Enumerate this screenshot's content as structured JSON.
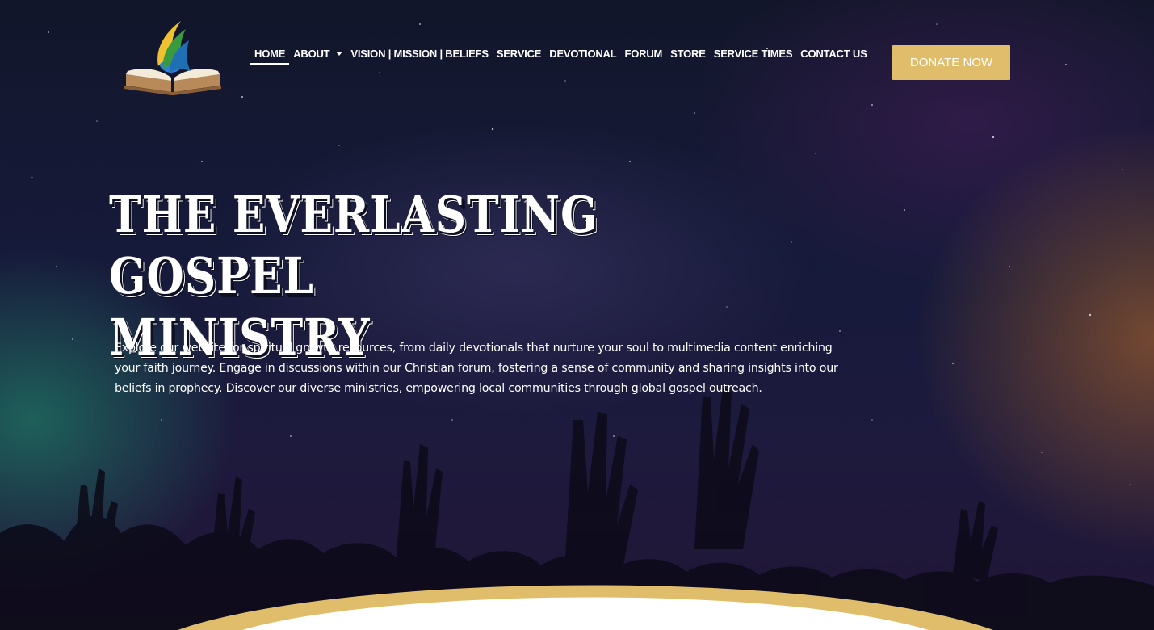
{
  "brand": {
    "logo_icon": "bible-flame-logo-icon",
    "accent_gold": "#dfbd6b"
  },
  "nav": {
    "items": [
      {
        "label": "HOME",
        "active": true
      },
      {
        "label": "ABOUT",
        "has_dropdown": true
      },
      {
        "label": "VISION | MISSION | BELIEFS"
      },
      {
        "label": "SERVICE"
      },
      {
        "label": "DEVOTIONAL"
      },
      {
        "label": "FORUM"
      },
      {
        "label": "STORE"
      },
      {
        "label": "SERVICE TIMES"
      },
      {
        "label": "CONTACT US"
      }
    ],
    "dropdown_icon": "chevron-down-icon"
  },
  "donate": {
    "label": "DONATE NOW"
  },
  "hero": {
    "title_line1": "THE EVERLASTING GOSPEL",
    "title_line2": "MINISTRY",
    "description": "Explore our website for spiritual growth resources, from daily devotionals that nurture your soul to multimedia content enriching your faith journey. Engage in discussions within our Christian forum, fostering a sense of community and sharing insights into our beliefs in prophecy. Discover our diverse ministries, empowering local communities through global gospel outreach."
  }
}
